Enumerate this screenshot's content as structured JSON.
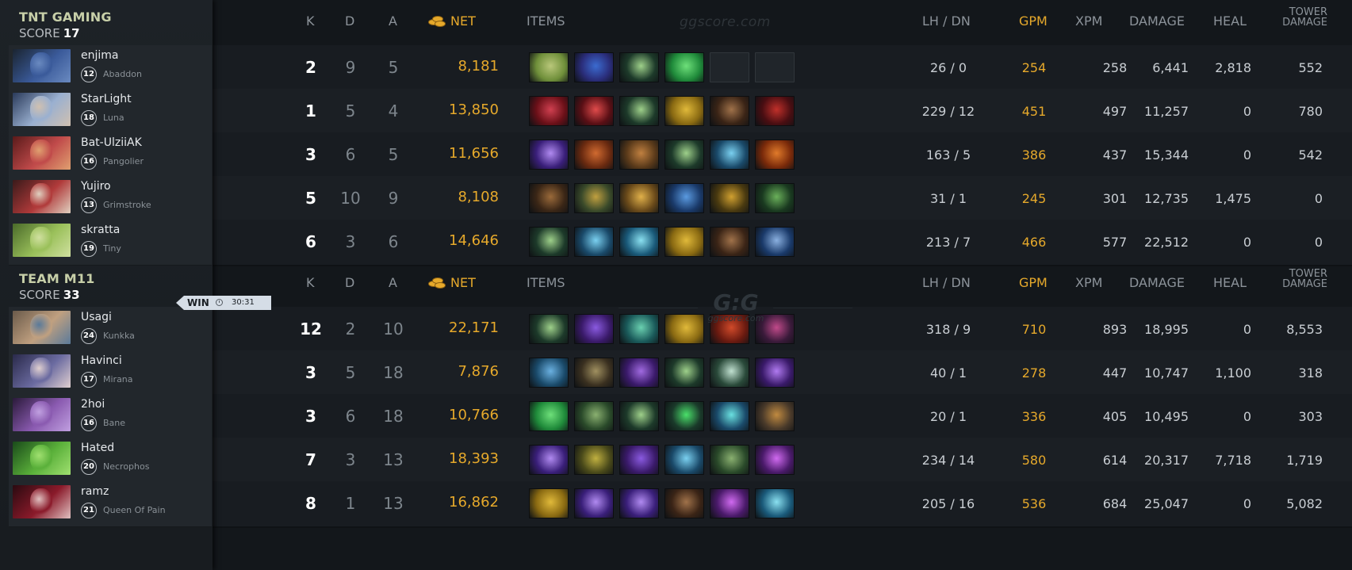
{
  "header": {
    "k": "K",
    "d": "D",
    "a": "A",
    "net": "NET",
    "items": "ITEMS",
    "lh_dn": "LH  /  DN",
    "gpm": "GPM",
    "xpm": "XPM",
    "damage": "DAMAGE",
    "heal": "HEAL",
    "tower_line1": "TOWER",
    "tower_line2": "DAMAGE",
    "watermark": "ggscore.com",
    "logo_big": "G:G",
    "logo_small": "ggscore.com"
  },
  "colors": {
    "gold": "#e6a92b",
    "team_name": "#c7cfa8",
    "background": "#13171b"
  },
  "result": {
    "label": "WIN",
    "time": "30:31",
    "icon": "clock-icon"
  },
  "teams": [
    {
      "name": "TNT GAMING",
      "score_label": "SCORE",
      "score": "17",
      "players": [
        {
          "name": "enjima",
          "level": "12",
          "hero": "Abaddon",
          "k": "2",
          "d": "9",
          "a": "5",
          "net": "8,181",
          "lh_dn": "26  /  0",
          "gpm": "254",
          "xpm": "258",
          "damage": "6,441",
          "heal": "2,818",
          "tower": "552",
          "items": [
            [
              "#6f8f3a",
              "#b9c77a"
            ],
            [
              "#2a2d7a",
              "#3b6bd0"
            ],
            [
              "#1d3a2a",
              "#9ed08a"
            ],
            [
              "#1f8a3a",
              "#6ee07a"
            ],
            null,
            null
          ]
        },
        {
          "name": "StarLight",
          "level": "18",
          "hero": "Luna",
          "k": "1",
          "d": "5",
          "a": "4",
          "net": "13,850",
          "lh_dn": "229  /  12",
          "gpm": "451",
          "xpm": "497",
          "damage": "11,257",
          "heal": "0",
          "tower": "780",
          "items": [
            [
              "#6b1018",
              "#d04050"
            ],
            [
              "#5a0f15",
              "#e04b4b"
            ],
            [
              "#1d3a2a",
              "#9ed08a"
            ],
            [
              "#8a6a12",
              "#e0b93a"
            ],
            [
              "#3a2416",
              "#a0724a"
            ],
            [
              "#4a0e12",
              "#c0302a"
            ]
          ]
        },
        {
          "name": "Bat-UlziiAK",
          "level": "16",
          "hero": "Pangolier",
          "k": "3",
          "d": "6",
          "a": "5",
          "net": "11,656",
          "lh_dn": "163  /  5",
          "gpm": "386",
          "xpm": "437",
          "damage": "15,344",
          "heal": "0",
          "tower": "542",
          "items": [
            [
              "#3a1f7a",
              "#b08af0"
            ],
            [
              "#6a2a10",
              "#d06a30"
            ],
            [
              "#5a3a1a",
              "#c08040"
            ],
            [
              "#1d3a2a",
              "#9ed08a"
            ],
            [
              "#1a4a6a",
              "#7ad0f0"
            ],
            [
              "#7a2a0a",
              "#e07a2a"
            ]
          ]
        },
        {
          "name": "Yujiro",
          "level": "13",
          "hero": "Grimstroke",
          "k": "5",
          "d": "10",
          "a": "9",
          "net": "8,108",
          "lh_dn": "31  /  1",
          "gpm": "245",
          "xpm": "301",
          "damage": "12,735",
          "heal": "1,475",
          "tower": "0",
          "items": [
            [
              "#3a2616",
              "#9a6a3a"
            ],
            [
              "#3a4a2a",
              "#c0a040"
            ],
            [
              "#6a4a1a",
              "#e0b04a"
            ],
            [
              "#1a3a6a",
              "#5a9ae0"
            ],
            [
              "#4a3a10",
              "#d0a030"
            ],
            [
              "#1a3a20",
              "#6ab05a"
            ]
          ]
        },
        {
          "name": "skratta",
          "level": "19",
          "hero": "Tiny",
          "k": "6",
          "d": "3",
          "a": "6",
          "net": "14,646",
          "lh_dn": "213  /  7",
          "gpm": "466",
          "xpm": "577",
          "damage": "22,512",
          "heal": "0",
          "tower": "0",
          "items": [
            [
              "#1d3a2a",
              "#9ed08a"
            ],
            [
              "#1a4a6a",
              "#7ad0f0"
            ],
            [
              "#1a5a7a",
              "#8ae0f0"
            ],
            [
              "#8a6a12",
              "#e0b93a"
            ],
            [
              "#3a2416",
              "#a0724a"
            ],
            [
              "#1a3a6a",
              "#8ab0e0"
            ]
          ]
        }
      ]
    },
    {
      "name": "TEAM M11",
      "score_label": "SCORE",
      "score": "33",
      "players": [
        {
          "name": "Usagi",
          "level": "24",
          "hero": "Kunkka",
          "k": "12",
          "d": "2",
          "a": "10",
          "net": "22,171",
          "lh_dn": "318  /  9",
          "gpm": "710",
          "xpm": "893",
          "damage": "18,995",
          "heal": "0",
          "tower": "8,553",
          "items": [
            [
              "#1d3a2a",
              "#9ed08a"
            ],
            [
              "#3a1a6a",
              "#8a5ae0"
            ],
            [
              "#1a5a5a",
              "#6ad0b0"
            ],
            [
              "#8a6a12",
              "#e0b93a"
            ],
            [
              "#6a1a10",
              "#d04a2a"
            ],
            [
              "#3a1a3a",
              "#c04a8a"
            ]
          ]
        },
        {
          "name": "Havinci",
          "level": "17",
          "hero": "Mirana",
          "k": "3",
          "d": "5",
          "a": "18",
          "net": "7,876",
          "lh_dn": "40  /  1",
          "gpm": "278",
          "xpm": "447",
          "damage": "10,747",
          "heal": "1,100",
          "tower": "318",
          "items": [
            [
              "#1a4a6a",
              "#6ab0e0"
            ],
            [
              "#3a3020",
              "#a09060"
            ],
            [
              "#3a1a6a",
              "#a06ae0"
            ],
            [
              "#1d3a2a",
              "#9ed08a"
            ],
            [
              "#2a4a3a",
              "#c0e0d0"
            ],
            [
              "#3a1a6a",
              "#b07af0"
            ]
          ]
        },
        {
          "name": "2hoi",
          "level": "16",
          "hero": "Bane",
          "k": "3",
          "d": "6",
          "a": "18",
          "net": "10,766",
          "lh_dn": "20  /  1",
          "gpm": "336",
          "xpm": "405",
          "damage": "10,495",
          "heal": "0",
          "tower": "303",
          "items": [
            [
              "#1f8a3a",
              "#6ee07a"
            ],
            [
              "#2a4a2a",
              "#8ab070"
            ],
            [
              "#1d3a2a",
              "#9ed08a"
            ],
            [
              "#1a3a2a",
              "#4ae06a"
            ],
            [
              "#1a4a6a",
              "#6ae0e0"
            ],
            [
              "#4a3a2a",
              "#c08a40"
            ]
          ]
        },
        {
          "name": "Hated",
          "level": "20",
          "hero": "Necrophos",
          "k": "7",
          "d": "3",
          "a": "13",
          "net": "18,393",
          "lh_dn": "234  /  14",
          "gpm": "580",
          "xpm": "614",
          "damage": "20,317",
          "heal": "7,718",
          "tower": "1,719",
          "items": [
            [
              "#3a1f7a",
              "#b08af0"
            ],
            [
              "#4a4a1a",
              "#c0b040"
            ],
            [
              "#3a1a6a",
              "#8a5ae0"
            ],
            [
              "#1a4a6a",
              "#7ad0f0"
            ],
            [
              "#2a4a2a",
              "#8ab070"
            ],
            [
              "#4a1a6a",
              "#d06af0"
            ]
          ]
        },
        {
          "name": "ramz",
          "level": "21",
          "hero": "Queen Of Pain",
          "k": "8",
          "d": "1",
          "a": "13",
          "net": "16,862",
          "lh_dn": "205  /  16",
          "gpm": "536",
          "xpm": "684",
          "damage": "25,047",
          "heal": "0",
          "tower": "5,082",
          "items": [
            [
              "#8a6a12",
              "#e0b93a"
            ],
            [
              "#3a1f7a",
              "#b08af0"
            ],
            [
              "#3a1f7a",
              "#b08af0"
            ],
            [
              "#3a2416",
              "#a0724a"
            ],
            [
              "#4a1a6a",
              "#d06af0"
            ],
            [
              "#1a5a7a",
              "#8ae0f0"
            ]
          ]
        }
      ]
    }
  ]
}
